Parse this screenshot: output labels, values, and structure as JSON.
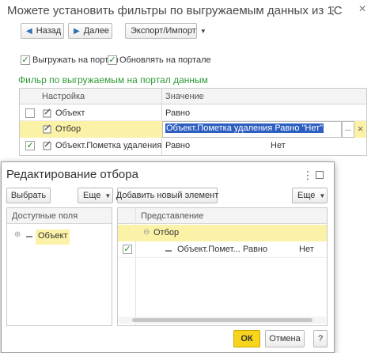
{
  "main_window": {
    "title": "Можете установить фильтры по выгружаемым данных из 1С",
    "toolbar": {
      "back_label": "Назад",
      "next_label": "Далее",
      "export_import_label": "Экспорт/Импорт"
    },
    "options": {
      "upload_to_portal": "Выгружать на портал",
      "update_on_portal": "Обновлять на портале"
    },
    "filter_section_title": "Фильр по выгружаемым на портал данным",
    "table": {
      "columns": [
        "Настройка",
        "Значение"
      ],
      "rows": [
        {
          "checked": false,
          "name": "Объект",
          "comparison": "Равно",
          "value": ""
        },
        {
          "checked": false,
          "name": "Отбор",
          "value": "Объект.Пометка удаления Равно \"Нет\"",
          "selected": true
        },
        {
          "checked": true,
          "name": "Объект.Пометка удаления",
          "comparison": "Равно",
          "value": "Нет"
        }
      ],
      "ellipsis": "...",
      "clear": "×"
    }
  },
  "dialog": {
    "title": "Редактирование отбора",
    "choose_label": "Выбрать",
    "more_label": "Еще",
    "add_element_label": "Добавить новый элемент",
    "more_label_right": "Еще",
    "available_fields_header": "Доступные поля",
    "tree_item": "Объект",
    "representation_header": "Представление",
    "group_label": "Отбор",
    "filter_row": {
      "field": "Объект.Помет...",
      "comparison": "Равно",
      "value": "Нет"
    },
    "ok_label": "ОК",
    "cancel_label": "Отмена",
    "help_label": "?"
  },
  "colors": {
    "accent_green": "#2f9a36",
    "selection_yellow": "#fbf1a7",
    "ok_yellow": "#f7d51d",
    "blue_selection": "#2d5fc1"
  }
}
